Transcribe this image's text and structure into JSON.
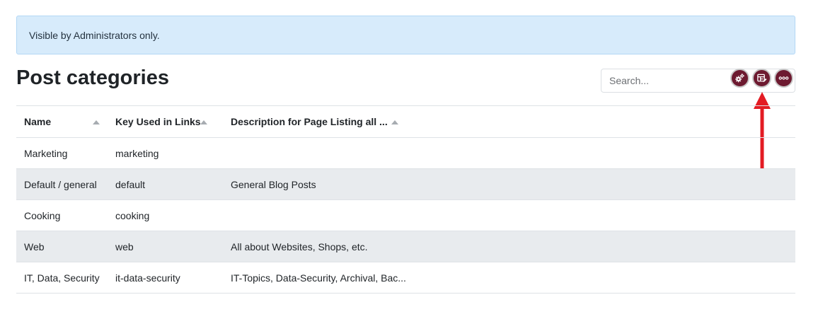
{
  "notice": {
    "text": "Visible by Administrators only."
  },
  "page": {
    "title": "Post categories"
  },
  "search": {
    "placeholder": "Search..."
  },
  "toolbar": {
    "icons": [
      "gears-icon",
      "table-edit-icon",
      "more-icon"
    ],
    "button_color": "#6d1a30"
  },
  "annotation": {
    "arrow_color": "#e31b23"
  },
  "table": {
    "columns": [
      "Name",
      "Key Used in Links",
      "Description for Page Listing all ..."
    ],
    "rows": [
      [
        "Marketing",
        "marketing",
        ""
      ],
      [
        "Default / general",
        "default",
        "General Blog Posts"
      ],
      [
        "Cooking",
        "cooking",
        ""
      ],
      [
        "Web",
        "web",
        "All about Websites, Shops, etc."
      ],
      [
        "IT, Data, Security",
        "it-data-security",
        "IT-Topics, Data-Security, Archival, Bac..."
      ]
    ]
  }
}
